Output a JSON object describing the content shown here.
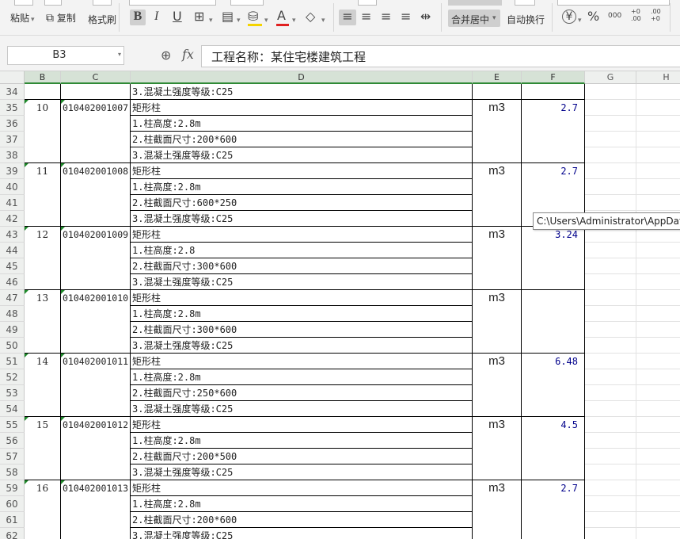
{
  "ribbon": {
    "paste_label": "粘贴",
    "copy_label": "复制",
    "format_painter_label": "格式刷",
    "bold": "B",
    "italic": "I",
    "underline": "U",
    "merge_center_label": "合并居中",
    "wrap_text_label": "自动换行",
    "currency_symbol": "¥",
    "percent_symbol": "%",
    "thousands_symbol": "000",
    "inc_decimal": "+0 .00",
    "dec_decimal": ".00 +0",
    "font_color_letter": "A"
  },
  "formula_bar": {
    "name_box": "B3",
    "fx": "fx",
    "content": "工程名称：某住宅楼建筑工程"
  },
  "columns": [
    "B",
    "C",
    "D",
    "E",
    "F",
    "G",
    "H"
  ],
  "rows": [
    {
      "num": "34",
      "b": "",
      "c": "",
      "d": "3.混凝土强度等级:C25",
      "e": "",
      "f": "",
      "first": false
    },
    {
      "num": "35",
      "b": "10",
      "c": "010402001007",
      "d": "矩形柱",
      "e": "m3",
      "f": "2.7",
      "first": true
    },
    {
      "num": "36",
      "b": "",
      "c": "",
      "d": "1.柱高度:2.8m",
      "e": "",
      "f": "",
      "first": false
    },
    {
      "num": "37",
      "b": "",
      "c": "",
      "d": "2.柱截面尺寸:200*600",
      "e": "",
      "f": "",
      "first": false
    },
    {
      "num": "38",
      "b": "",
      "c": "",
      "d": "3.混凝土强度等级:C25",
      "e": "",
      "f": "",
      "first": false
    },
    {
      "num": "39",
      "b": "11",
      "c": "010402001008",
      "d": "矩形柱",
      "e": "m3",
      "f": "2.7",
      "first": true
    },
    {
      "num": "40",
      "b": "",
      "c": "",
      "d": "1.柱高度:2.8m",
      "e": "",
      "f": "",
      "first": false
    },
    {
      "num": "41",
      "b": "",
      "c": "",
      "d": "2.柱截面尺寸:600*250",
      "e": "",
      "f": "",
      "first": false
    },
    {
      "num": "42",
      "b": "",
      "c": "",
      "d": "3.混凝土强度等级:C25",
      "e": "",
      "f": "",
      "first": false
    },
    {
      "num": "43",
      "b": "12",
      "c": "010402001009",
      "d": "矩形柱",
      "e": "m3",
      "f": "3.24",
      "first": true
    },
    {
      "num": "44",
      "b": "",
      "c": "",
      "d": "1.柱高度:2.8",
      "e": "",
      "f": "",
      "first": false
    },
    {
      "num": "45",
      "b": "",
      "c": "",
      "d": "2.柱截面尺寸:300*600",
      "e": "",
      "f": "",
      "first": false
    },
    {
      "num": "46",
      "b": "",
      "c": "",
      "d": "3.混凝土强度等级:C25",
      "e": "",
      "f": "",
      "first": false
    },
    {
      "num": "47",
      "b": "13",
      "c": "010402001010",
      "d": "矩形柱",
      "e": "m3",
      "f": "",
      "first": true
    },
    {
      "num": "48",
      "b": "",
      "c": "",
      "d": "1.柱高度:2.8m",
      "e": "",
      "f": "",
      "first": false
    },
    {
      "num": "49",
      "b": "",
      "c": "",
      "d": "2.柱截面尺寸:300*600",
      "e": "",
      "f": "",
      "first": false
    },
    {
      "num": "50",
      "b": "",
      "c": "",
      "d": "3.混凝土强度等级:C25",
      "e": "",
      "f": "",
      "first": false
    },
    {
      "num": "51",
      "b": "14",
      "c": "010402001011",
      "d": "矩形柱",
      "e": "m3",
      "f": "6.48",
      "first": true
    },
    {
      "num": "52",
      "b": "",
      "c": "",
      "d": "1.柱高度:2.8m",
      "e": "",
      "f": "",
      "first": false
    },
    {
      "num": "53",
      "b": "",
      "c": "",
      "d": "2.柱截面尺寸:250*600",
      "e": "",
      "f": "",
      "first": false
    },
    {
      "num": "54",
      "b": "",
      "c": "",
      "d": "3.混凝土强度等级:C25",
      "e": "",
      "f": "",
      "first": false
    },
    {
      "num": "55",
      "b": "15",
      "c": "010402001012",
      "d": "矩形柱",
      "e": "m3",
      "f": "4.5",
      "first": true
    },
    {
      "num": "56",
      "b": "",
      "c": "",
      "d": "1.柱高度:2.8m",
      "e": "",
      "f": "",
      "first": false
    },
    {
      "num": "57",
      "b": "",
      "c": "",
      "d": "2.柱截面尺寸:200*500",
      "e": "",
      "f": "",
      "first": false
    },
    {
      "num": "58",
      "b": "",
      "c": "",
      "d": "3.混凝土强度等级:C25",
      "e": "",
      "f": "",
      "first": false
    },
    {
      "num": "59",
      "b": "16",
      "c": "010402001013",
      "d": "矩形柱",
      "e": "m3",
      "f": "2.7",
      "first": true
    },
    {
      "num": "60",
      "b": "",
      "c": "",
      "d": "1.柱高度:2.8m",
      "e": "",
      "f": "",
      "first": false
    },
    {
      "num": "61",
      "b": "",
      "c": "",
      "d": "2.柱截面尺寸:200*600",
      "e": "",
      "f": "",
      "first": false
    },
    {
      "num": "62",
      "b": "",
      "c": "",
      "d": "3.混凝土强度等级:C25",
      "e": "",
      "f": "",
      "first": false
    }
  ],
  "tooltip": "C:\\Users\\Administrator\\AppData",
  "colors": {
    "accent_green": "#2f8a36",
    "value_blue": "#00008b"
  }
}
